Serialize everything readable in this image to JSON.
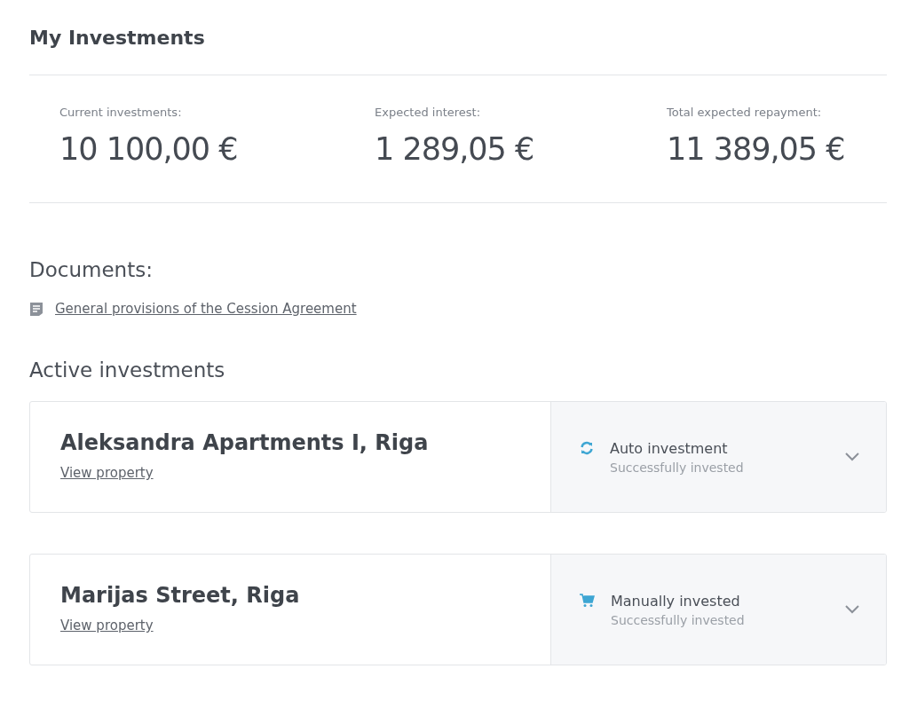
{
  "title": "My Investments",
  "stats": [
    {
      "label": "Current investments:",
      "value": "10 100,00 €"
    },
    {
      "label": "Expected interest:",
      "value": "1 289,05 €"
    },
    {
      "label": "Total expected repayment:",
      "value": "11 389,05 €"
    }
  ],
  "documents": {
    "heading": "Documents:",
    "links": [
      "General provisions of the Cession Agreement"
    ]
  },
  "active": {
    "heading": "Active investments",
    "items": [
      {
        "name": "Aleksandra Apartments I, Riga",
        "link": "View property",
        "kind": "auto",
        "type_label": "Auto investment",
        "status": "Successfully invested"
      },
      {
        "name": "Marijas Street, Riga",
        "link": "View property",
        "kind": "manual",
        "type_label": "Manually invested",
        "status": "Successfully invested"
      }
    ]
  }
}
